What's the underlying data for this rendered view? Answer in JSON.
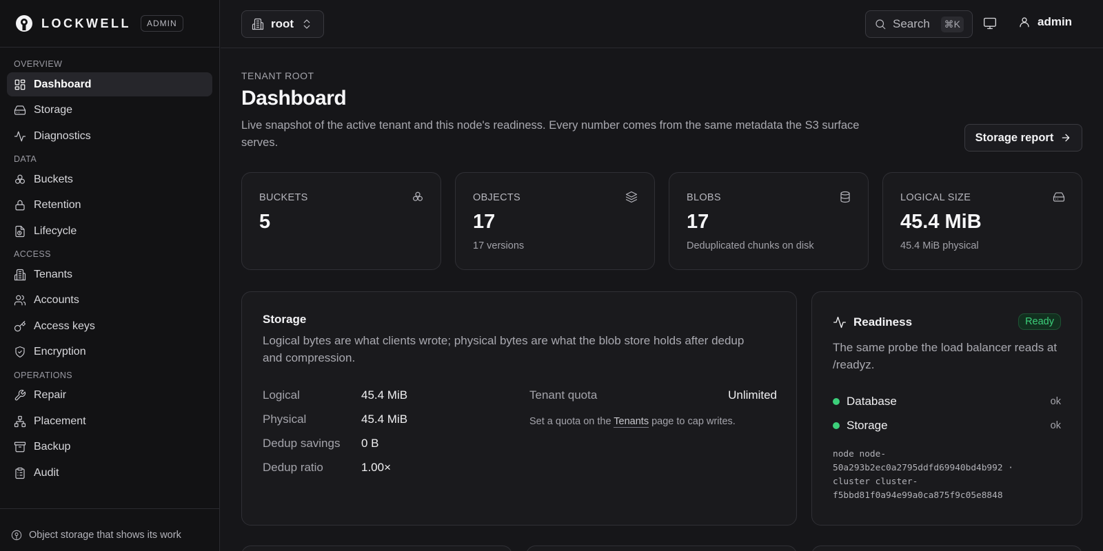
{
  "brand": {
    "name": "LOCKWELL",
    "badge": "ADMIN"
  },
  "sidebar": {
    "sections": [
      {
        "label": "OVERVIEW",
        "items": [
          {
            "label": "Dashboard",
            "icon": "dashboard-icon",
            "active": true
          },
          {
            "label": "Storage",
            "icon": "hard-drive-icon"
          },
          {
            "label": "Diagnostics",
            "icon": "activity-icon"
          }
        ]
      },
      {
        "label": "DATA",
        "items": [
          {
            "label": "Buckets",
            "icon": "buckets-icon"
          },
          {
            "label": "Retention",
            "icon": "lock-icon"
          },
          {
            "label": "Lifecycle",
            "icon": "file-clock-icon"
          }
        ]
      },
      {
        "label": "ACCESS",
        "items": [
          {
            "label": "Tenants",
            "icon": "building-icon"
          },
          {
            "label": "Accounts",
            "icon": "users-icon"
          },
          {
            "label": "Access keys",
            "icon": "key-icon"
          },
          {
            "label": "Encryption",
            "icon": "shield-icon"
          }
        ]
      },
      {
        "label": "OPERATIONS",
        "items": [
          {
            "label": "Repair",
            "icon": "wrench-icon"
          },
          {
            "label": "Placement",
            "icon": "network-icon"
          },
          {
            "label": "Backup",
            "icon": "archive-icon"
          },
          {
            "label": "Audit",
            "icon": "clipboard-icon"
          }
        ]
      }
    ],
    "footer": "Object storage that shows its work"
  },
  "topbar": {
    "tenant": "root",
    "search_label": "Search",
    "search_shortcut": "⌘K",
    "user": "admin"
  },
  "page": {
    "eyebrow": "TENANT ROOT",
    "title": "Dashboard",
    "description": "Live snapshot of the active tenant and this node's readiness. Every number comes from the same metadata the S3 surface serves.",
    "report_button": "Storage report"
  },
  "stats": [
    {
      "label": "BUCKETS",
      "value": "5",
      "sub": "",
      "icon": "buckets-icon"
    },
    {
      "label": "OBJECTS",
      "value": "17",
      "sub": "17 versions",
      "icon": "layers-icon"
    },
    {
      "label": "BLOBS",
      "value": "17",
      "sub": "Deduplicated chunks on disk",
      "icon": "database-icon"
    },
    {
      "label": "LOGICAL SIZE",
      "value": "45.4 MiB",
      "sub": "45.4 MiB physical",
      "icon": "hard-drive-icon"
    }
  ],
  "storage": {
    "title": "Storage",
    "description": "Logical bytes are what clients wrote; physical bytes are what the blob store holds after dedup and compression.",
    "metrics": [
      {
        "label": "Logical",
        "value": "45.4 MiB"
      },
      {
        "label": "Physical",
        "value": "45.4 MiB"
      },
      {
        "label": "Dedup savings",
        "value": "0 B"
      },
      {
        "label": "Dedup ratio",
        "value": "1.00×"
      }
    ],
    "quota_label": "Tenant quota",
    "quota_value": "Unlimited",
    "quota_note_prefix": "Set a quota on the ",
    "quota_note_link": "Tenants",
    "quota_note_suffix": " page to cap writes."
  },
  "readiness": {
    "title": "Readiness",
    "badge": "Ready",
    "description": "The same probe the load balancer reads at /readyz.",
    "checks": [
      {
        "label": "Database",
        "status": "ok"
      },
      {
        "label": "Storage",
        "status": "ok"
      }
    ],
    "node_line1": "node node-",
    "node_line2": "50a293b2ec0a2795ddfd69940bd4b992 ·",
    "node_line3": "cluster cluster-",
    "node_line4": "f5bbd81f0a94e99a0ca875f9c05e8848"
  },
  "colors": {
    "accent_green": "#3ccf7a",
    "background": "#161619",
    "sidebar": "#121214"
  }
}
